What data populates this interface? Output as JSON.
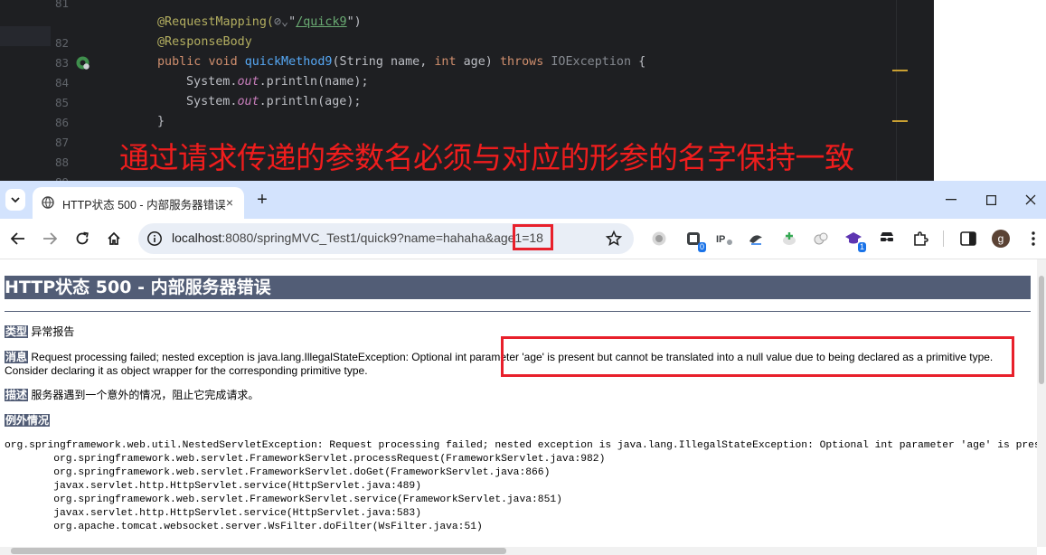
{
  "ide": {
    "line_numbers": [
      "81",
      "82",
      "83",
      "84",
      "85",
      "86",
      "87",
      "88"
    ],
    "line81": {
      "annotation": "@RequestMapping(",
      "chip": "⊘⌄",
      "quote_open": "\"",
      "path": "/quick9",
      "quote_close": "\")"
    },
    "line82": {
      "annotation": "@ResponseBody"
    },
    "line83": {
      "kw_public": "public",
      "kw_void": "void",
      "method": "quickMethod9",
      "params_a": "(String name, ",
      "kw_int": "int",
      "params_b": " age) ",
      "kw_throws": "throws",
      "exception": "IOException",
      "brace": " {"
    },
    "line84": {
      "a": "System.",
      "field": "out",
      "b": ".println(name);"
    },
    "line85": {
      "a": "System.",
      "field": "out",
      "b": ".println(age);"
    },
    "line86": {
      "text": "}"
    },
    "overlay_note": "通过请求传递的参数名必须与对应的形参的名字保持一致"
  },
  "browser": {
    "tab_title": "HTTP状态 500 - 内部服务器错误",
    "tab_close": "×",
    "new_tab": "+",
    "url_host": "localhost",
    "url_rest": ":8080/springMVC_Test1/quick9?name=hahaha&age1=18",
    "extensions": [
      "record-icon",
      "extension-badge-icon",
      "ip-icon",
      "bird-icon",
      "plus-cloud-icon",
      "puzzle-cloud-icon",
      "graduation-cap-icon",
      "spy-icon",
      "puzzle-icon"
    ],
    "ext_badges": {
      "badge_a": "0",
      "badge_b": "1"
    },
    "avatar_letter": "g"
  },
  "page": {
    "title": "HTTP状态 500 - 内部服务器错误",
    "type_label": "类型",
    "type_value": "异常报告",
    "message_label": "消息",
    "message_line1": "Request processing failed; nested exception is java.lang.IllegalStateException: Optional int parameter 'age' is present but cannot be translated into a null value due to being declared as a primitive type.",
    "message_line2": "Consider declaring it as object wrapper for the corresponding primitive type.",
    "description_label": "描述",
    "description_value": "服务器遇到一个意外的情况，阻止它完成请求。",
    "exception_label": "例外情况",
    "stack_trace": "org.springframework.web.util.NestedServletException: Request processing failed; nested exception is java.lang.IllegalStateException: Optional int parameter 'age' is present but cannot be translated into a null value due to being declared as a primitive type.\n\torg.springframework.web.servlet.FrameworkServlet.processRequest(FrameworkServlet.java:982)\n\torg.springframework.web.servlet.FrameworkServlet.doGet(FrameworkServlet.java:866)\n\tjavax.servlet.http.HttpServlet.service(HttpServlet.java:489)\n\torg.springframework.web.servlet.FrameworkServlet.service(FrameworkServlet.java:851)\n\tjavax.servlet.http.HttpServlet.service(HttpServlet.java:583)\n\torg.apache.tomcat.websocket.server.WsFilter.doFilter(WsFilter.java:51)"
  },
  "colors": {
    "annotation_red": "#e8202b",
    "tomcat_header": "#525d76",
    "ide_background": "#1e1f22"
  }
}
